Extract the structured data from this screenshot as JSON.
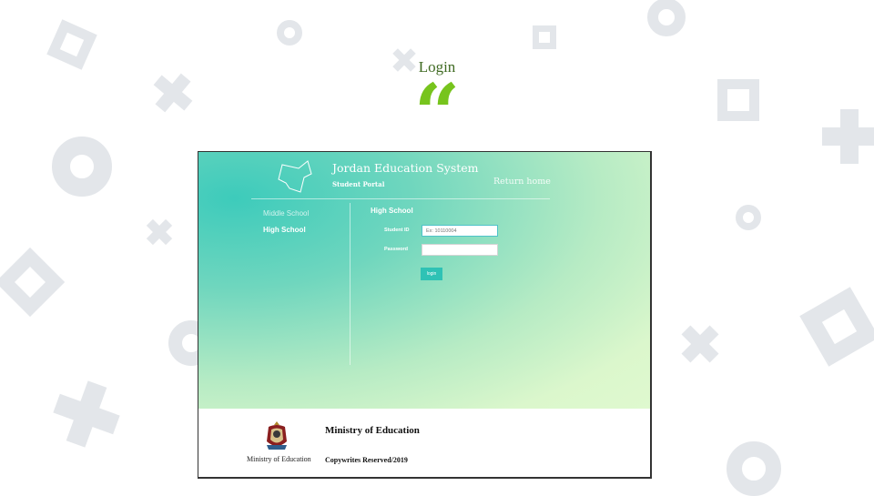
{
  "slide": {
    "title": "Login",
    "quote_mark": "“",
    "accent_color": "#77c41d",
    "title_color": "#3f6a22",
    "decoration_color": "#e3e6ea"
  },
  "portal": {
    "system_title": "Jordan Education System",
    "subtitle": "Student Portal",
    "return_home": "Return home",
    "map_icon": "jordan-map-outline-icon",
    "gradient_colors": [
      "#3dcbbb",
      "#dff9cf"
    ],
    "nav": [
      {
        "label": "Middle School",
        "active": false
      },
      {
        "label": "High School",
        "active": true
      }
    ],
    "form": {
      "heading": "High School",
      "student_id_label": "Student ID",
      "student_id_placeholder": "Ex: 10110004",
      "password_label": "Password",
      "password_value": "",
      "login_label": "login",
      "button_color": "#2fc2b5"
    }
  },
  "footer": {
    "crest_icon": "coat-of-arms-icon",
    "crest_caption": "Ministry of Education",
    "ministry_name": "Ministry of Education",
    "copyright": "Copywrites Reserved/2019"
  }
}
